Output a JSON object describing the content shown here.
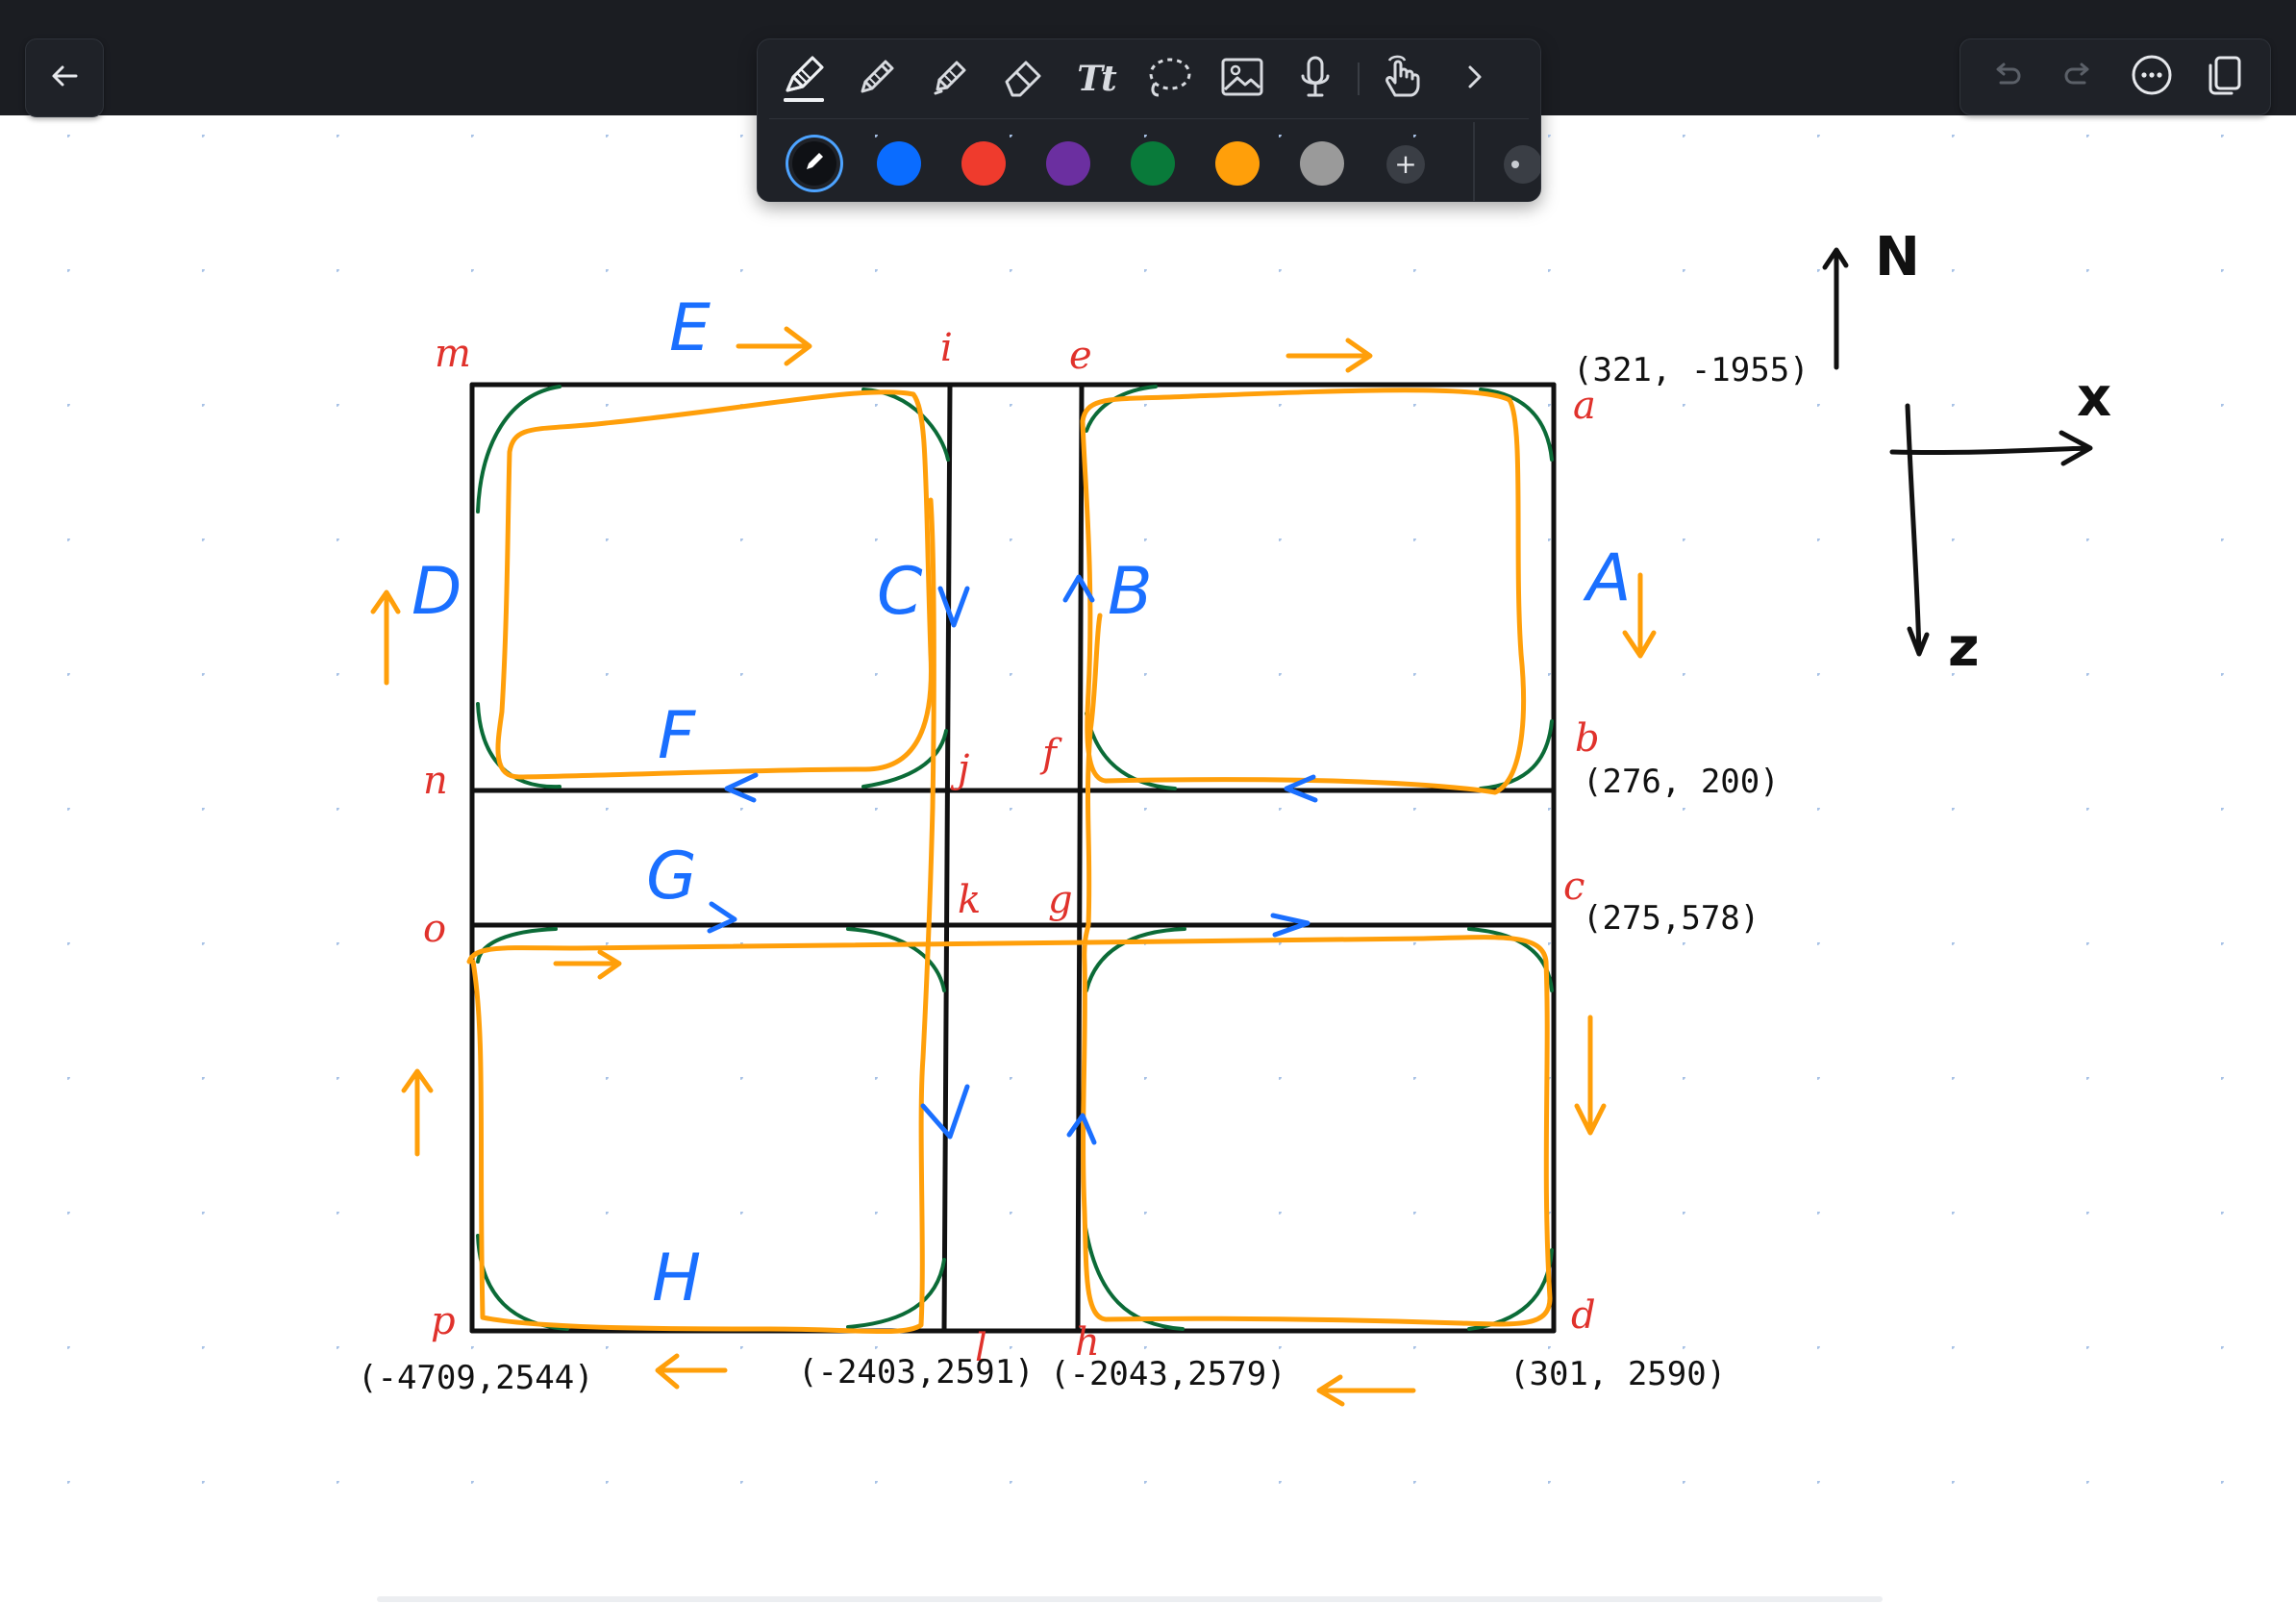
{
  "toolbar": {
    "back_icon": "arrow-left-icon",
    "tools": [
      {
        "name": "pen-tool",
        "icon": "fountain-pen-icon",
        "active": true
      },
      {
        "name": "pencil-tool",
        "icon": "pencil-icon"
      },
      {
        "name": "highlighter-tool",
        "icon": "highlighter-icon"
      },
      {
        "name": "eraser-tool",
        "icon": "eraser-icon"
      },
      {
        "name": "text-tool",
        "icon": "text-icon",
        "label": "Tt"
      },
      {
        "name": "lasso-tool",
        "icon": "lasso-icon"
      },
      {
        "name": "image-tool",
        "icon": "image-icon"
      },
      {
        "name": "microphone-tool",
        "icon": "microphone-icon"
      },
      {
        "name": "hand-tool",
        "icon": "finger-touch-icon"
      },
      {
        "name": "more-tools",
        "icon": "chevron-right-icon"
      }
    ],
    "colors": [
      {
        "name": "black",
        "hex": "#0f1115",
        "selected": true
      },
      {
        "name": "blue",
        "hex": "#0a6cff"
      },
      {
        "name": "red",
        "hex": "#ef3b2d"
      },
      {
        "name": "purple",
        "hex": "#6b2fa0"
      },
      {
        "name": "green",
        "hex": "#097a3a"
      },
      {
        "name": "orange",
        "hex": "#ff9f0a"
      },
      {
        "name": "gray",
        "hex": "#9a9a9a"
      }
    ],
    "add_color_label": "+",
    "right_actions": [
      {
        "name": "undo-button",
        "icon": "undo-icon",
        "enabled": false
      },
      {
        "name": "redo-button",
        "icon": "redo-icon",
        "enabled": false
      },
      {
        "name": "more-button",
        "icon": "ellipsis-circle-icon"
      },
      {
        "name": "pages-button",
        "icon": "pages-icon"
      }
    ]
  },
  "canvas": {
    "vertex_labels": {
      "m": "m",
      "i": "i",
      "e": "e",
      "a": "a",
      "n": "n",
      "j": "j",
      "f": "f",
      "b": "b",
      "o": "o",
      "k": "k",
      "g": "g",
      "c": "c",
      "p": "p",
      "l": "l",
      "h": "h",
      "d": "d"
    },
    "road_labels": {
      "A": "A",
      "B": "B",
      "C": "C",
      "D": "D",
      "E": "E",
      "F": "F",
      "G": "G",
      "H": "H"
    },
    "coordinates": {
      "a": "(321, -1955)",
      "b": "(276, 200)",
      "c": "(275,578)",
      "d": "(301, 2590)",
      "p": "(-4709,2544)",
      "l": "(-2403,2591)",
      "h": "(-2043,2579)"
    },
    "compass": {
      "north": "N",
      "x_axis": "x",
      "z_axis": "z"
    },
    "colors": {
      "grid": "#111111",
      "route": "#ff9f0a",
      "corners": "#0b6b37",
      "labels_red": "#e0322c",
      "labels_blue": "#1a6fff"
    }
  }
}
